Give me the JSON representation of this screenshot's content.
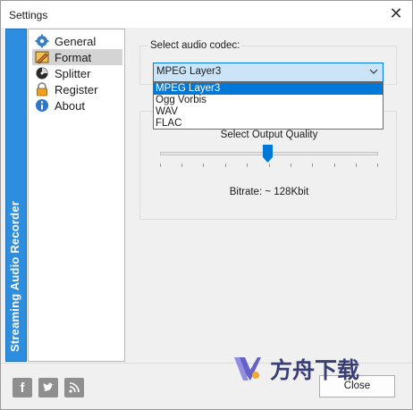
{
  "window": {
    "title": "Settings"
  },
  "sidebar_banner": {
    "text": "Streaming Audio Recorder"
  },
  "nav": {
    "items": [
      {
        "label": "General",
        "icon": "gear-icon"
      },
      {
        "label": "Format",
        "icon": "pencil-icon",
        "selected": true
      },
      {
        "label": "Splitter",
        "icon": "splitter-icon"
      },
      {
        "label": "Register",
        "icon": "lock-icon"
      },
      {
        "label": "About",
        "icon": "info-icon"
      }
    ]
  },
  "codec": {
    "group_label": "Select audio codec:",
    "selected": "MPEG Layer3",
    "options": [
      "MPEG Layer3",
      "Ogg Vorbis",
      "WAV",
      "FLAC"
    ]
  },
  "quality": {
    "label": "Select Output Quality",
    "slider_position": 0.5,
    "bitrate_text": "Bitrate: ~ 128Kbit"
  },
  "footer": {
    "social": [
      "facebook-icon",
      "twitter-icon",
      "rss-icon"
    ],
    "close_label": "Close",
    "watermark_text": "方舟下载"
  },
  "colors": {
    "accent": "#0078d7",
    "banner": "#2d8ee0",
    "combo_bg": "#cce4f7"
  }
}
